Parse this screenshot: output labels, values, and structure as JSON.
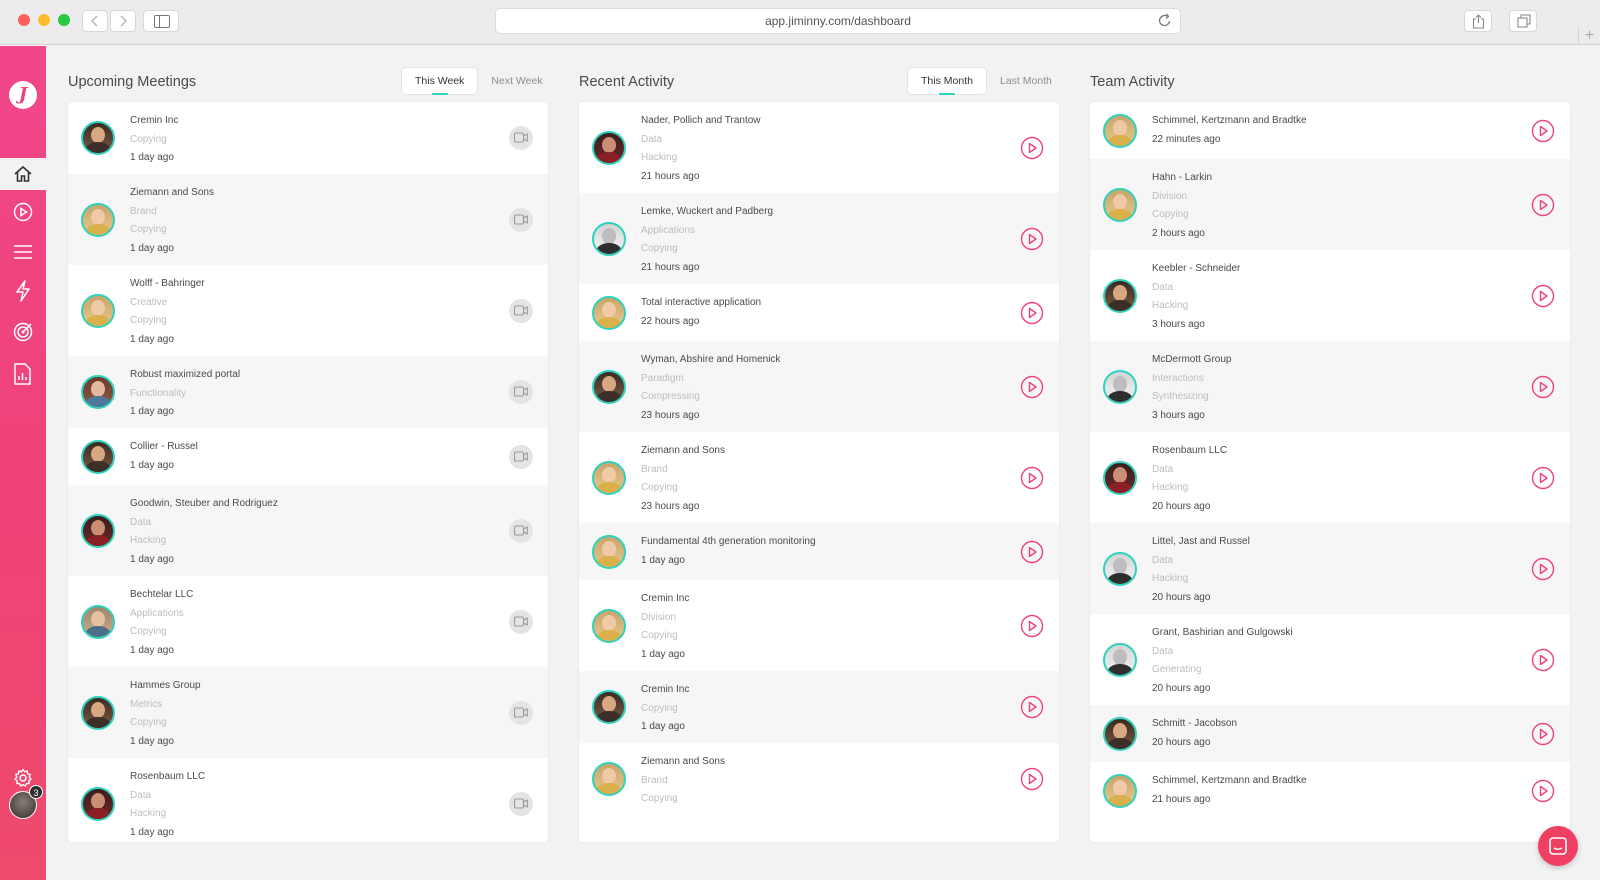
{
  "browser": {
    "url": "app.jiminny.com/dashboard",
    "new_tab_symbol": "+"
  },
  "app": {
    "logo_letter": "J",
    "accent_color": "#ef4277",
    "teal_color": "#2ad6c0",
    "notification_count": "3",
    "sidebar_icons": [
      "home-icon",
      "play-circle-icon",
      "list-icon",
      "lightning-icon",
      "target-icon",
      "report-icon",
      "gear-icon"
    ]
  },
  "upcoming": {
    "title": "Upcoming Meetings",
    "tabs": [
      {
        "label": "This Week",
        "active": true
      },
      {
        "label": "Next Week",
        "active": false
      }
    ],
    "items": [
      {
        "name": "Cremin Inc",
        "tags": [
          "Copying"
        ],
        "time": "1 day ago",
        "avatar": "man"
      },
      {
        "name": "Ziemann and Sons",
        "tags": [
          "Brand",
          "Copying"
        ],
        "time": "1 day ago",
        "avatar": "woman"
      },
      {
        "name": "Wolff - Bahringer",
        "tags": [
          "Creative",
          "Copying"
        ],
        "time": "1 day ago",
        "avatar": "woman"
      },
      {
        "name": "Robust maximized portal",
        "tags": [
          "Functionality"
        ],
        "time": "1 day ago",
        "avatar": "curly"
      },
      {
        "name": "Collier - Russel",
        "tags": [],
        "time": "1 day ago",
        "avatar": "man"
      },
      {
        "name": "Goodwin, Steuber and Rodriguez",
        "tags": [
          "Data",
          "Hacking"
        ],
        "time": "1 day ago",
        "avatar": "red"
      },
      {
        "name": "Bechtelar LLC",
        "tags": [
          "Applications",
          "Copying"
        ],
        "time": "1 day ago",
        "avatar": "glasses"
      },
      {
        "name": "Hammes Group",
        "tags": [
          "Metrics",
          "Copying"
        ],
        "time": "1 day ago",
        "avatar": "man"
      },
      {
        "name": "Rosenbaum LLC",
        "tags": [
          "Data",
          "Hacking"
        ],
        "time": "1 day ago",
        "avatar": "red"
      }
    ]
  },
  "recent": {
    "title": "Recent Activity",
    "tabs": [
      {
        "label": "This Month",
        "active": true
      },
      {
        "label": "Last Month",
        "active": false
      }
    ],
    "items": [
      {
        "name": "Nader, Pollich and Trantow",
        "tags": [
          "Data",
          "Hacking"
        ],
        "time": "21 hours ago",
        "avatar": "red"
      },
      {
        "name": "Lemke, Wuckert and Padberg",
        "tags": [
          "Applications",
          "Copying"
        ],
        "time": "21 hours ago",
        "avatar": "bw"
      },
      {
        "name": "Total interactive application",
        "tags": [],
        "time": "22 hours ago",
        "avatar": "woman"
      },
      {
        "name": "Wyman, Abshire and Homenick",
        "tags": [
          "Paradigm",
          "Compressing"
        ],
        "time": "23 hours ago",
        "avatar": "man"
      },
      {
        "name": "Ziemann and Sons",
        "tags": [
          "Brand",
          "Copying"
        ],
        "time": "23 hours ago",
        "avatar": "woman"
      },
      {
        "name": "Fundamental 4th generation monitoring",
        "tags": [],
        "time": "1 day ago",
        "avatar": "woman"
      },
      {
        "name": "Cremin Inc",
        "tags": [
          "Division",
          "Copying"
        ],
        "time": "1 day ago",
        "avatar": "woman"
      },
      {
        "name": "Cremin Inc",
        "tags": [
          "Copying"
        ],
        "time": "1 day ago",
        "avatar": "man"
      },
      {
        "name": "Ziemann and Sons",
        "tags": [
          "Brand",
          "Copying"
        ],
        "time": "",
        "avatar": "woman"
      }
    ]
  },
  "team": {
    "title": "Team Activity",
    "items": [
      {
        "name": "Schimmel, Kertzmann and Bradtke",
        "tags": [],
        "time": "22 minutes ago",
        "avatar": "woman"
      },
      {
        "name": "Hahn - Larkin",
        "tags": [
          "Division",
          "Copying"
        ],
        "time": "2 hours ago",
        "avatar": "woman"
      },
      {
        "name": "Keebler - Schneider",
        "tags": [
          "Data",
          "Hacking"
        ],
        "time": "3 hours ago",
        "avatar": "man"
      },
      {
        "name": "McDermott Group",
        "tags": [
          "Interactions",
          "Synthesizing"
        ],
        "time": "3 hours ago",
        "avatar": "bw"
      },
      {
        "name": "Rosenbaum LLC",
        "tags": [
          "Data",
          "Hacking"
        ],
        "time": "20 hours ago",
        "avatar": "red"
      },
      {
        "name": "Littel, Jast and Russel",
        "tags": [
          "Data",
          "Hacking"
        ],
        "time": "20 hours ago",
        "avatar": "bw"
      },
      {
        "name": "Grant, Bashirian and Gulgowski",
        "tags": [
          "Data",
          "Generating"
        ],
        "time": "20 hours ago",
        "avatar": "bw"
      },
      {
        "name": "Schmitt - Jacobson",
        "tags": [],
        "time": "20 hours ago",
        "avatar": "man"
      },
      {
        "name": "Schimmel, Kertzmann and Bradtke",
        "tags": [],
        "time": "21 hours ago",
        "avatar": "woman"
      }
    ]
  }
}
